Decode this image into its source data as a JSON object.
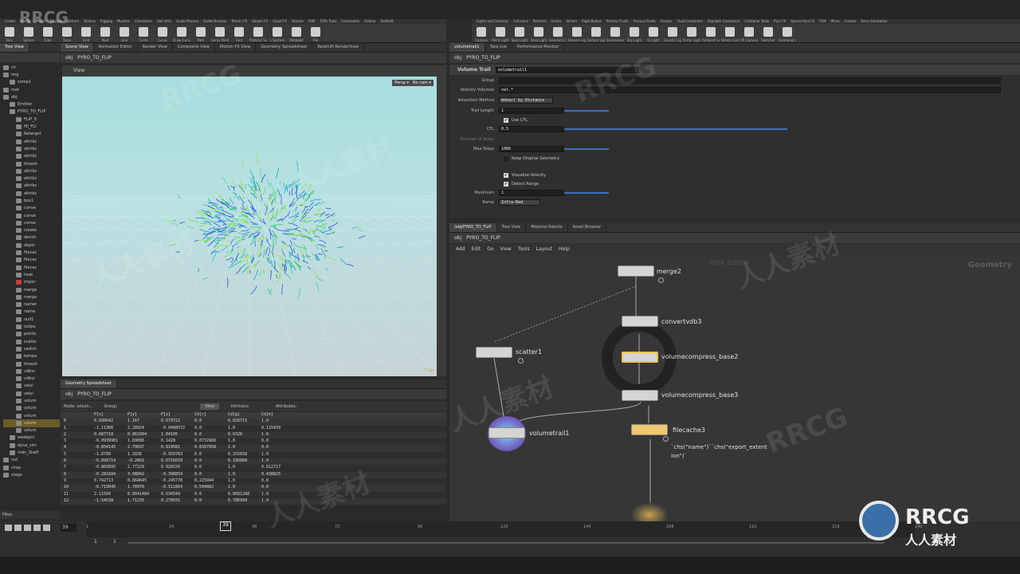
{
  "watermark": {
    "brand": "RRCG",
    "brand_cn": "人人素材"
  },
  "shelf": {
    "tabs": [
      "Create",
      "Modify",
      "Model",
      "Polygon",
      "Deform",
      "Texture",
      "Rigging",
      "Muscles",
      "Characters",
      "Hair Utils",
      "Guide Process",
      "Guide Brushes",
      "Terrain FX",
      "Simple FX",
      "Cloud FX",
      "Volume",
      "FEM",
      "TOPs Tools",
      "Constraints",
      "Octane",
      "Redshift"
    ],
    "tools": [
      "Box",
      "Sphere",
      "Tube",
      "Torus",
      "Grid",
      "Null",
      "Line",
      "Circle",
      "Curve",
      "Draw Curve",
      "Path",
      "Spray Paint",
      "Font",
      "Platonic Solids",
      "L-System",
      "Metaball",
      "File"
    ],
    "tabs_right": [
      "Lights and Cameras",
      "Collisions",
      "Particles",
      "Grains",
      "Vellum",
      "Rigid Bodies",
      "Particle Fluids",
      "Viscous Fluids",
      "Oceans",
      "Fluid Containers",
      "Populate Containers",
      "Container Tools",
      "Pyro FX",
      "Sparse Pyro FX",
      "FEM",
      "Wires",
      "Crowds",
      "Drive Simulation"
    ],
    "tools_right": [
      "Camera",
      "Point Light",
      "Spot Light",
      "Area Light",
      "Geometry Light",
      "Volume Light",
      "Distant Light",
      "Environment Light",
      "Sky Light",
      "GI Light",
      "Caustic Light",
      "Portal Light",
      "Ambient Light",
      "Stereo Camera",
      "VR Camera",
      "Switcher",
      "Gamepad Camera"
    ]
  },
  "left_panel": {
    "tree_tab": "Tree View",
    "viewer_tabs": [
      "Scene View",
      "Animation Editor",
      "Render View",
      "Composite View",
      "Motion FX View",
      "Geometry Spreadsheet",
      "Redshift RenderView"
    ],
    "path_root": "obj",
    "path_node": "PYRO_TO_FLIP",
    "view_label": "View",
    "persp_button": "Persp ▾",
    "cam_button": "No cam ▾",
    "corner_label": "Y Up",
    "tree_items": [
      "ch",
      "img",
      "comp1",
      "mat",
      "obj",
      "Emitter",
      "PYRO_TO_FLIP",
      "FLIP_S",
      "fill_FLI",
      "Retarget",
      "attribc",
      "attribc",
      "attribc",
      "timesh",
      "attribc",
      "attribc",
      "attribc",
      "attribc",
      "box1",
      "conve",
      "conve",
      "conve",
      "create",
      "densit",
      "dopio",
      "filecac",
      "filecac",
      "filecac",
      "heat",
      "impor",
      "merge",
      "merge",
      "namer",
      "name",
      "null1",
      "outpu",
      "points",
      "scatte",
      "switch",
      "tempe",
      "timesh",
      "vdbvi",
      "vdbvi",
      "velyi",
      "velyi",
      "volum",
      "volum",
      "volum",
      "volum",
      "volum",
      "weakpnt",
      "dyna_sim",
      "mdn_Shelf",
      "out",
      "shop",
      "stage"
    ],
    "filter_label": "Filter"
  },
  "spreadsheet": {
    "tab": "Geometry Spreadsheet",
    "node_label": "Node: volum...",
    "group_label": "Group:",
    "view_button": "View",
    "intrinsics_label": "Intrinsics",
    "attributes_label": "Attributes:",
    "columns": [
      "",
      "P[x]",
      "P[y]",
      "P[z]",
      "Cd[r]",
      "Cd[g]",
      "Cd[b]"
    ],
    "rows": [
      [
        "0",
        "0.836642",
        "1.167",
        "0.679721",
        "0.0",
        "0.828715",
        "1.0"
      ],
      [
        "1",
        "-1.11306",
        "2.28924",
        "-0.0468572",
        "0.0",
        "1.0",
        "0.115439"
      ],
      [
        "2",
        "0.687718",
        "0.861094",
        "1.04105",
        "0.0",
        "0.6328",
        "1.0"
      ],
      [
        "3",
        "-0.0939901",
        "1.69896",
        "0.1428",
        "0.0732966",
        "1.0",
        "0.0"
      ],
      [
        "4",
        "-0.854145",
        "2.79037",
        "0.819581",
        "0.8397958",
        "1.0",
        "0.0"
      ],
      [
        "5",
        "-1.8799",
        "1.5836",
        "-0.959763",
        "0.0",
        "0.255838",
        "1.0"
      ],
      [
        "6",
        "-0.896714",
        "-0.2661",
        "0.0716659",
        "0.0",
        "0.186888",
        "1.0"
      ],
      [
        "7",
        "-0.869995",
        "2.77229",
        "0.928156",
        "0.0",
        "1.0",
        "0.612717"
      ],
      [
        "8",
        "-0.281684",
        "3.08042",
        "-0.398854",
        "0.0",
        "1.0",
        "0.438825"
      ],
      [
        "9",
        "0.742713",
        "0.864645",
        "-0.245778",
        "0.225944",
        "1.0",
        "0.0"
      ],
      [
        "10",
        "-0.719045",
        "1.78976",
        "-0.511864",
        "0.594882",
        "1.0",
        "0.0"
      ],
      [
        "11",
        "2.11584",
        "0.0041484",
        "0.634549",
        "0.0",
        "0.0681288",
        "1.0"
      ],
      [
        "12",
        "-1.54538",
        "1.71235",
        "0.278031",
        "0.0",
        "0.786999",
        "1.0"
      ]
    ]
  },
  "params": {
    "tabs": [
      "volumetrail1",
      "Take List",
      "Performance Monitor"
    ],
    "path_root": "obj",
    "path_node": "PYRO_TO_FLIP",
    "node_type": "Volume Trail",
    "node_name": "volumetrail1",
    "rows": {
      "group": "Group",
      "velocity_volumes_label": "Velocity Volumes",
      "velocity_volumes_value": "vel.*",
      "advection_label": "Advection Method",
      "advection_value": "Advect by Distance",
      "trail_length_label": "Trail Length",
      "trail_length_value": "1",
      "use_cfl_label": "Use CFL",
      "cfl_label": "CFL",
      "cfl_value": "0.5",
      "num_steps_label": "Number of Steps",
      "max_steps_label": "Max Steps",
      "max_steps_value": "1000",
      "keep_geo_label": "Keep Original Geometry",
      "visualize_label": "Visualize Velocity",
      "detect_label": "Detect Range",
      "maximum_label": "Maximum",
      "maximum_value": "1",
      "ramp_label": "Ramp",
      "ramp_value": "Infra-Red"
    }
  },
  "network": {
    "tabs": [
      "/obj/PYRO_TO_FLIP",
      "Tree View",
      "Material Palette",
      "Asset Browser"
    ],
    "path_root": "obj",
    "path_node": "PYRO_TO_FLIP",
    "menu": [
      "Add",
      "Edit",
      "Go",
      "View",
      "Tools",
      "Layout",
      "Help"
    ],
    "context_label": "Geometry",
    "hint_label": "Indie Edition",
    "nodes": {
      "merge": "merge2",
      "convert": "convertvdb3",
      "compress2": "volumecompress_base2",
      "compress3": "volumecompress_base3",
      "scatter": "scatter1",
      "trail": "volumetrail1",
      "filecache": "filecache3",
      "expr1": "`chs(\"name\")``chs(\"export_extent",
      "expr2": "ion\")`"
    }
  },
  "timeline": {
    "current_frame": "39",
    "ticks": [
      "1",
      "24",
      "48",
      "72",
      "96",
      "120",
      "144",
      "168",
      "192",
      "216",
      "240"
    ],
    "start": "1",
    "start2": "1"
  },
  "colors": {
    "accent": "#e8a23a",
    "selection": "#f0c24a",
    "viewport_bg": "#a7dedd"
  }
}
